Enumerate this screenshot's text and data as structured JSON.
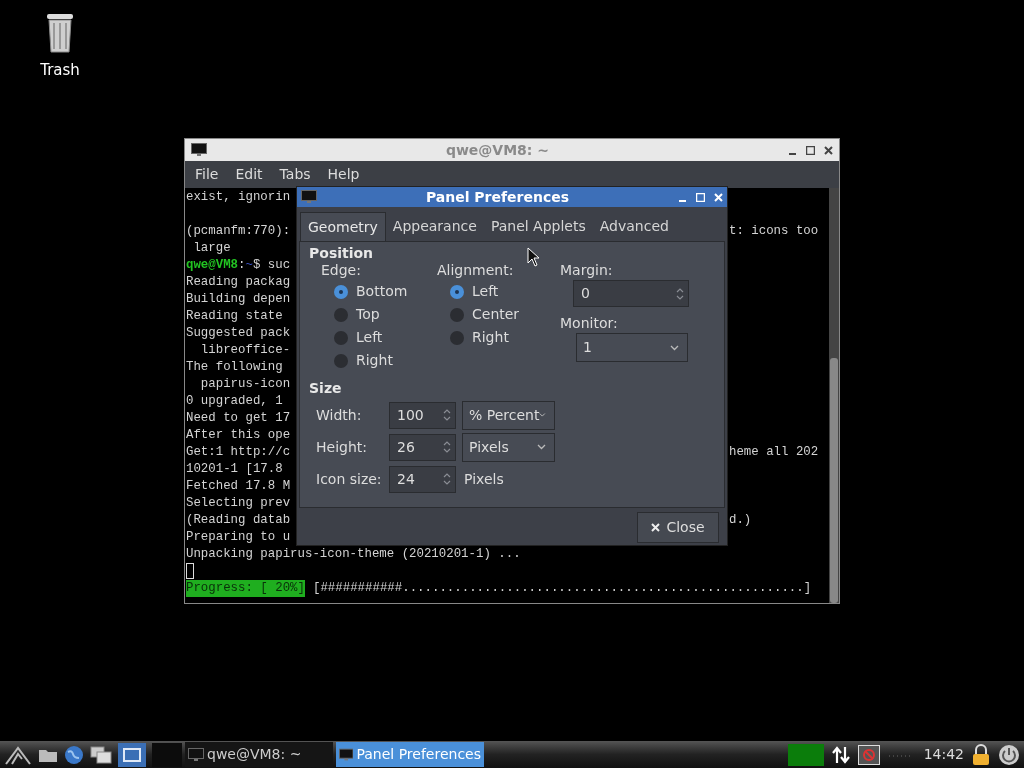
{
  "desktop_icons": [
    {
      "label": "Trash"
    }
  ],
  "terminal": {
    "title": "qwe@VM8: ~",
    "menu": [
      "File",
      "Edit",
      "Tabs",
      "Help"
    ],
    "lines": [
      {
        "left": "exist, ignorin"
      },
      {
        "kind": "blank"
      },
      {
        "left": "(pcmanfm:770):",
        "right": "t: icons too"
      },
      {
        "left": " large"
      },
      {
        "kind": "prompt",
        "user": "qwe@VM8",
        "sep": ":",
        "dir": "~",
        "left": "$ suc"
      },
      {
        "left": "Reading packag"
      },
      {
        "left": "Building depen"
      },
      {
        "left": "Reading state"
      },
      {
        "left": "Suggested pack"
      },
      {
        "left": "  libreoffice-"
      },
      {
        "left": "The following"
      },
      {
        "left": "  papirus-icon"
      },
      {
        "left": "0 upgraded, 1"
      },
      {
        "left": "Need to get 17"
      },
      {
        "left": "After this ope"
      },
      {
        "left": "Get:1 http://c",
        "right": "heme all 202"
      },
      {
        "left": "10201-1 [17.8"
      },
      {
        "left": "Fetched 17.8 M"
      },
      {
        "left": "Selecting prev"
      },
      {
        "left": "(Reading datab",
        "right": "d.)"
      },
      {
        "left": "Preparing to u"
      },
      {
        "left": "Unpacking papirus-icon-theme (20210201-1) ..."
      },
      {
        "kind": "cursor"
      }
    ],
    "progress": {
      "label": "Progress: [ 20%]",
      "bar": "[###########......................................................]"
    }
  },
  "dialog": {
    "title": "Panel Preferences",
    "tabs": [
      {
        "label": "Geometry",
        "selected": true
      },
      {
        "label": "Appearance",
        "selected": false
      },
      {
        "label": "Panel Applets",
        "selected": false
      },
      {
        "label": "Advanced",
        "selected": false
      }
    ],
    "position_heading": "Position",
    "edge": {
      "label": "Edge:",
      "options": [
        {
          "label": "Bottom",
          "selected": true
        },
        {
          "label": "Top",
          "selected": false
        },
        {
          "label": "Left",
          "selected": false
        },
        {
          "label": "Right",
          "selected": false
        }
      ]
    },
    "alignment": {
      "label": "Alignment:",
      "options": [
        {
          "label": "Left",
          "selected": true
        },
        {
          "label": "Center",
          "selected": false
        },
        {
          "label": "Right",
          "selected": false
        }
      ]
    },
    "margin": {
      "label": "Margin:",
      "value": "0"
    },
    "monitor": {
      "label": "Monitor:",
      "value": "1"
    },
    "size_heading": "Size",
    "size_rows": [
      {
        "label": "Width:",
        "value": "100",
        "unit": "% Percent",
        "kind": "dropdown"
      },
      {
        "label": "Height:",
        "value": "26",
        "unit": "Pixels",
        "kind": "dropdown"
      },
      {
        "label": "Icon size:",
        "value": "24",
        "unit": "Pixels",
        "kind": "text"
      }
    ],
    "close": "Close"
  },
  "taskbar": {
    "tasks": [
      {
        "label": "qwe@VM8: ~",
        "selected": false
      },
      {
        "label": "Panel Preferences",
        "selected": true
      }
    ],
    "clock": "14:42"
  }
}
